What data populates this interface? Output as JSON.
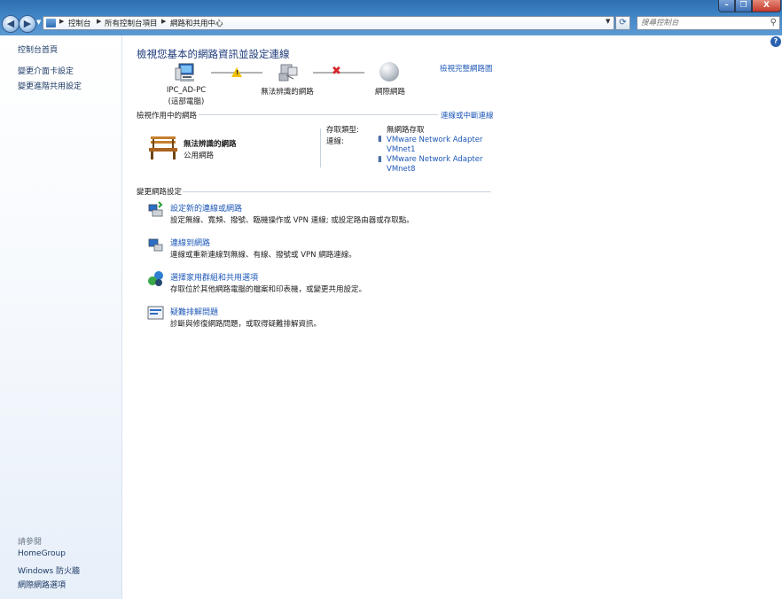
{
  "window": {
    "min_label": "–",
    "max_label": "❐",
    "close_label": "X"
  },
  "address": {
    "crumbs": [
      "控制台",
      "所有控制台項目",
      "網路和共用中心"
    ],
    "search_placeholder": "搜尋控制台"
  },
  "left_pane": {
    "home": "控制台首頁",
    "links": [
      "變更介面卡設定",
      "變更進階共用設定"
    ],
    "see_also_heading": "請參閱",
    "see_also": [
      "HomeGroup",
      "Windows 防火牆",
      "網際網路選項"
    ]
  },
  "main": {
    "title": "檢視您基本的網路資訊並設定連線",
    "view_full_map": "檢視完整網路圖",
    "map": {
      "computer_name": "IPC_AD-PC",
      "computer_sub": "(這部電腦)",
      "network_name": "無法辨識的網路",
      "internet_name": "網際網路"
    },
    "active_section": {
      "heading": "檢視作用中的網路",
      "connect_link": "連線或中斷連線",
      "network_name": "無法辨識的網路",
      "network_type": "公用網路",
      "access_type_label": "存取類型:",
      "access_type_value": "無網路存取",
      "connections_label": "連線:",
      "connections": [
        "VMware Network Adapter VMnet1",
        "VMware Network Adapter VMnet8"
      ]
    },
    "change_section": {
      "heading": "變更網路設定",
      "tasks": [
        {
          "title": "設定新的連線或網路",
          "desc": "設定無線、寬頻、撥號、臨機操作或 VPN 連線; 或設定路由器或存取點。"
        },
        {
          "title": "連線到網路",
          "desc": "連線或重新連線到無線、有線、撥號或 VPN 網路連線。"
        },
        {
          "title": "選擇家用群組和共用選項",
          "desc": "存取位於其他網路電腦的檔案和印表機，或變更共用設定。"
        },
        {
          "title": "疑難排解問題",
          "desc": "診斷與修復網路問題，或取得疑難排解資訊。"
        }
      ]
    }
  }
}
